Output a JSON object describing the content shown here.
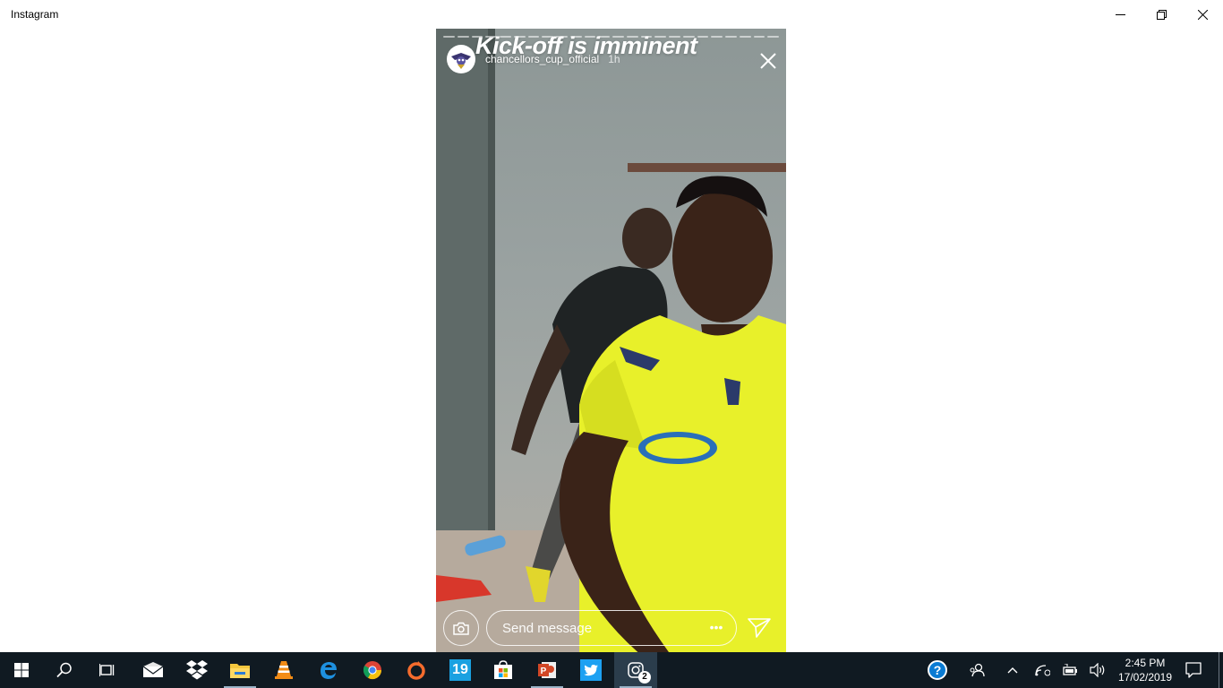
{
  "window": {
    "title": "Instagram",
    "controls": [
      "minimize",
      "restore",
      "close"
    ]
  },
  "story": {
    "caption": "Kick-off is imminent",
    "username": "chancellors_cup_official",
    "time": "1h",
    "progress_segments": 24,
    "reply_placeholder": "Send message",
    "more_label": "•••"
  },
  "taskbar": {
    "apps": [
      {
        "name": "start-button",
        "icon": "windows-logo-icon"
      },
      {
        "name": "search-button",
        "icon": "search-icon"
      },
      {
        "name": "task-view-button",
        "icon": "task-view-icon"
      },
      {
        "name": "mail-app",
        "icon": "mail-icon"
      },
      {
        "name": "dropbox-app",
        "icon": "dropbox-icon"
      },
      {
        "name": "file-explorer-app",
        "icon": "folder-icon",
        "running": true
      },
      {
        "name": "vlc-app",
        "icon": "vlc-cone-icon"
      },
      {
        "name": "edge-app",
        "icon": "edge-icon"
      },
      {
        "name": "chrome-app",
        "icon": "chrome-icon"
      },
      {
        "name": "origin-app",
        "icon": "origin-icon"
      },
      {
        "name": "app-19",
        "icon": "nineteen-tile-icon",
        "label": "19"
      },
      {
        "name": "store-app",
        "icon": "store-bag-icon"
      },
      {
        "name": "powerpoint-app",
        "icon": "powerpoint-icon",
        "running": true
      },
      {
        "name": "twitter-app",
        "icon": "twitter-bird-icon"
      },
      {
        "name": "instagram-app",
        "icon": "instagram-icon",
        "running": true,
        "active": true,
        "badge": "2"
      }
    ],
    "tray": {
      "help_icon": "help-icon",
      "people_icon": "people-icon",
      "chevron_icon": "chevron-up-icon",
      "network_icon": "wifi-icon",
      "battery_icon": "battery-icon",
      "volume_icon": "volume-icon",
      "time": "2:45 PM",
      "date": "17/02/2019",
      "notification_icon": "action-center-icon"
    }
  },
  "colors": {
    "taskbar": "#101a22",
    "jersey": "#e8f02a",
    "accent": "#0078d7"
  }
}
